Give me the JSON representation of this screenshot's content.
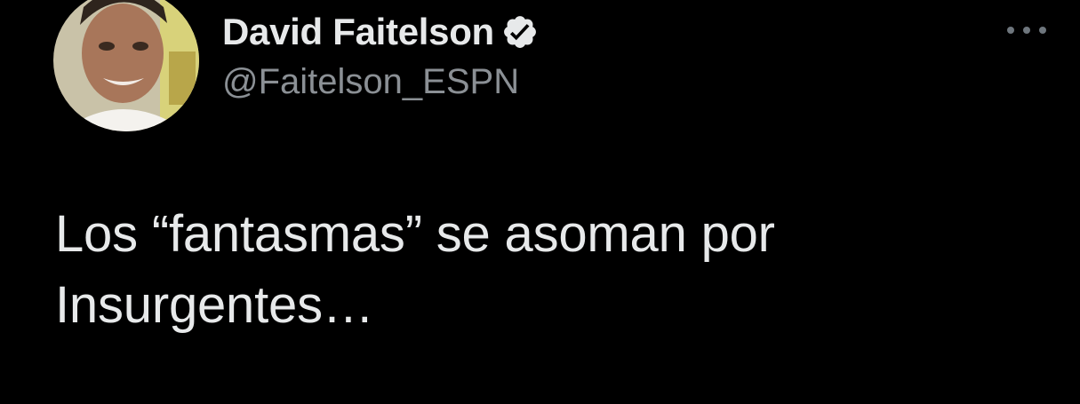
{
  "author": {
    "display_name": "David Faitelson",
    "handle": "@Faitelson_ESPN",
    "verified": true,
    "avatar_icon": "profile-photo"
  },
  "more_menu": {
    "icon": "more-horizontal-icon"
  },
  "tweet": {
    "text": "Los “fantasmas” se asoman por\nInsurgentes…"
  },
  "colors": {
    "background": "#000000",
    "text": "#e7e9ea",
    "secondary": "#8b9095",
    "icon": "#6e767d"
  }
}
